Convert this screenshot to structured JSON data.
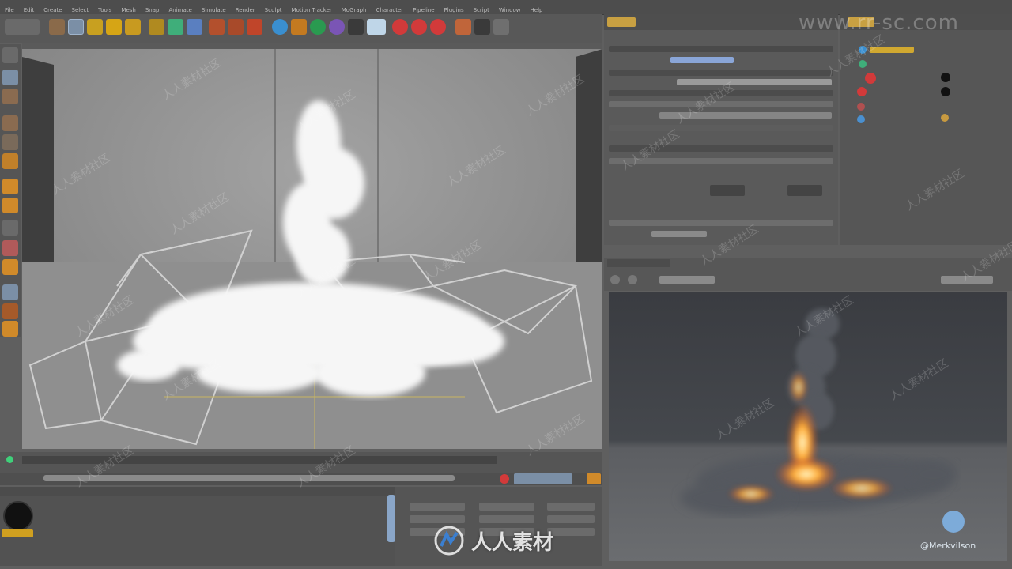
{
  "menubar": {
    "items": [
      "File",
      "Edit",
      "Create",
      "Select",
      "Tools",
      "Mesh",
      "Snap",
      "Animate",
      "Simulate",
      "Render",
      "Sculpt",
      "Motion Tracker",
      "MoGraph",
      "Character",
      "Pipeline",
      "Plugins",
      "Script",
      "Window",
      "Help"
    ]
  },
  "watermarks": {
    "site": "www.rr-sc.com",
    "tile": "人人素材社区",
    "logo_text": "人人素材"
  },
  "credit": "@Merkvilson",
  "icons": {
    "toolbar": [
      "undo-icon",
      "live-select-icon",
      "move-icon",
      "scale-icon",
      "rotate-icon",
      "axis-icon",
      "x-lock-icon",
      "y-lock-icon",
      "z-lock-icon",
      "coordinate-system-icon",
      "render-view-icon",
      "render-picture-viewer-icon",
      "edit-render-settings-icon",
      "cube-icon",
      "pen-icon",
      "subdivision-icon",
      "array-icon",
      "cloner-icon",
      "deformer-icon",
      "floor-icon",
      "camera-icon",
      "light-icon",
      "record-icon",
      "autokey-icon",
      "keyframe-icon",
      "layout-icon",
      "snap-icon",
      "workplane-icon"
    ],
    "objects": [
      "explosia-icon",
      "emitter-icon",
      "turbulence-icon",
      "wind-icon",
      "floor-object-icon",
      "camera-object-icon"
    ]
  },
  "colors": {
    "accent": "#7b8fa6",
    "record": "#d23a3a",
    "fire": "#ff8a1f"
  }
}
